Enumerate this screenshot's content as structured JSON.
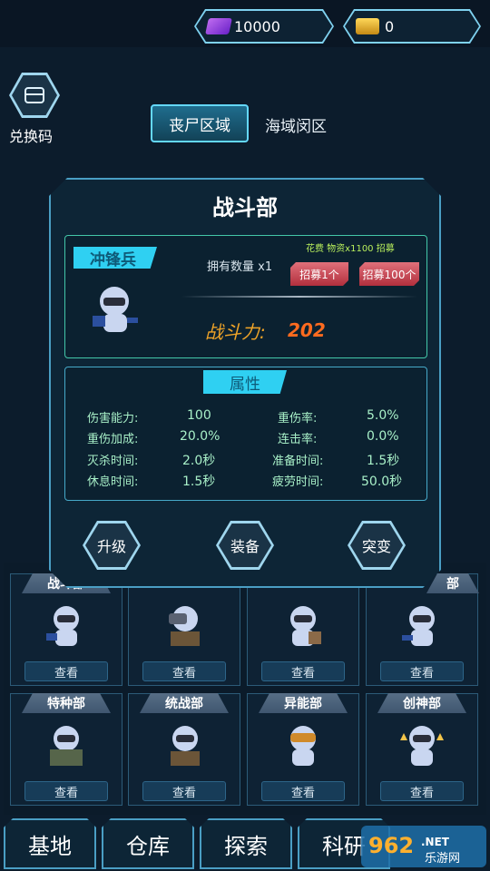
{
  "currency": {
    "gems": "10000",
    "gold": "0"
  },
  "code_button": {
    "label": "兑换码"
  },
  "tabs": [
    {
      "label": "丧尸区域",
      "active": true
    },
    {
      "label": "海域闵区",
      "active": false
    }
  ],
  "dialog": {
    "title": "战斗部",
    "unit": {
      "name": "冲锋兵",
      "owned": "拥有数量 x1",
      "cost": "花费 物资x1100 招募",
      "recruit_one": "招募1个",
      "recruit_hundred": "招募100个",
      "power_label": "战斗力:",
      "power_value": "202"
    },
    "attributes": {
      "title": "属性",
      "rows": [
        {
          "l1": "伤害能力:",
          "v1": "100",
          "l2": "重伤率:",
          "v2": "5.0%"
        },
        {
          "l1": "重伤加成:",
          "v1": "20.0%",
          "l2": "连击率:",
          "v2": "0.0%"
        },
        {
          "l1": "灭杀时间:",
          "v1": "2.0秒",
          "l2": "准备时间:",
          "v2": "1.5秒"
        },
        {
          "l1": "休息时间:",
          "v1": "1.5秒",
          "l2": "疲劳时间:",
          "v2": "50.0秒"
        }
      ]
    },
    "actions": {
      "upgrade": "升级",
      "equip": "装备",
      "breakthrough": "突变"
    }
  },
  "departments": [
    {
      "name": "战斗部",
      "button": "查看"
    },
    {
      "name": "",
      "button": "查看"
    },
    {
      "name": "",
      "button": "查看"
    },
    {
      "name": "部",
      "button": "查看"
    },
    {
      "name": "特种部",
      "button": "查看"
    },
    {
      "name": "统战部",
      "button": "查看"
    },
    {
      "name": "异能部",
      "button": "查看"
    },
    {
      "name": "创神部",
      "button": "查看"
    }
  ],
  "bottom_nav": [
    "基地",
    "仓库",
    "探索",
    "科研"
  ],
  "watermark": {
    "text": "962",
    "sub": "乐游网",
    "suffix": ".NET"
  },
  "colors": {
    "accent": "#2fd0f2",
    "power": "#ff6b1f",
    "attr_text": "#a8f0c8",
    "recruit": "#c23a48"
  }
}
